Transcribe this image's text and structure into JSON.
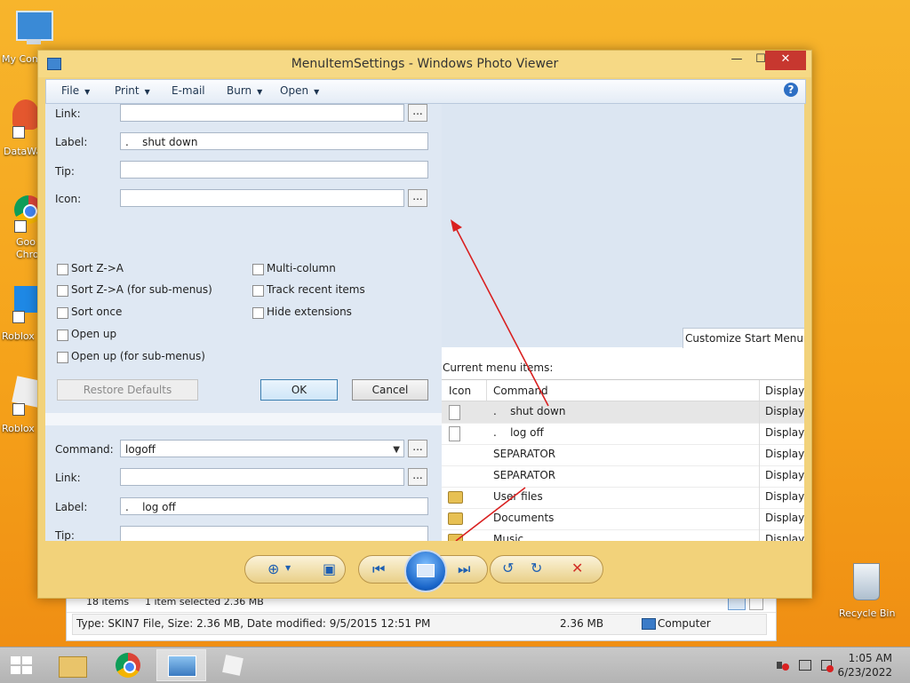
{
  "desktop": {
    "icons": [
      {
        "label": "My Com"
      },
      {
        "label": "DataWa"
      },
      {
        "label": "Goo\nChro"
      },
      {
        "label": "Roblox"
      },
      {
        "label": "Roblox"
      }
    ],
    "recycle_bin": "Recycle Bin"
  },
  "explorer": {
    "items_count": "18 items",
    "selected": "1 item selected  2.36 MB",
    "type_info": "Type: SKIN7 File, Size: 2.36 MB, Date modified: 9/5/2015 12:51 PM",
    "size": "2.36 MB",
    "location": "Computer"
  },
  "window": {
    "title": "MenuItemSettings - Windows Photo Viewer",
    "minimize": "—",
    "maximize": "☐",
    "close": "✕"
  },
  "menubar": {
    "file": "File",
    "print": "Print",
    "email": "E-mail",
    "burn": "Burn",
    "open": "Open",
    "help": "?"
  },
  "settings": {
    "link_label": "Link:",
    "label_label": "Label:",
    "label_value": ".    shut down",
    "tip_label": "Tip:",
    "icon_label": "Icon:",
    "dots": "...",
    "checkboxes_left": [
      "Sort Z->A",
      "Sort Z->A (for sub-menus)",
      "Sort once",
      "Open up",
      "Open up (for sub-menus)"
    ],
    "checkboxes_right": [
      "Multi-column",
      "Track recent items",
      "Hide extensions"
    ],
    "restore_defaults": "Restore Defaults",
    "ok": "OK",
    "cancel": "Cancel",
    "command_label": "Command:",
    "command_value": "logoff",
    "link2_label": "Link:",
    "label2_label": "Label:",
    "label2_value": ".    log off",
    "tip2_label": "Tip:"
  },
  "customize": {
    "tab": "Customize Start Menu",
    "current_items": "Current menu items:",
    "columns": [
      "Icon",
      "Command",
      "Display"
    ],
    "rows": [
      {
        "command": ".    shut down",
        "display": "Display a",
        "icon": "doc"
      },
      {
        "command": ".    log off",
        "display": "Display a",
        "icon": "doc"
      },
      {
        "command": "SEPARATOR",
        "display": "Display t",
        "icon": "none"
      },
      {
        "command": "SEPARATOR",
        "display": "Display t",
        "icon": "none"
      },
      {
        "command": "User files",
        "display": "Display a",
        "icon": "folder"
      },
      {
        "command": "Documents",
        "display": "Display a",
        "icon": "folder"
      },
      {
        "command": "Music",
        "display": "Display a",
        "icon": "folder"
      }
    ]
  },
  "taskbar": {
    "time": "1:05 AM",
    "date": "6/23/2022"
  }
}
